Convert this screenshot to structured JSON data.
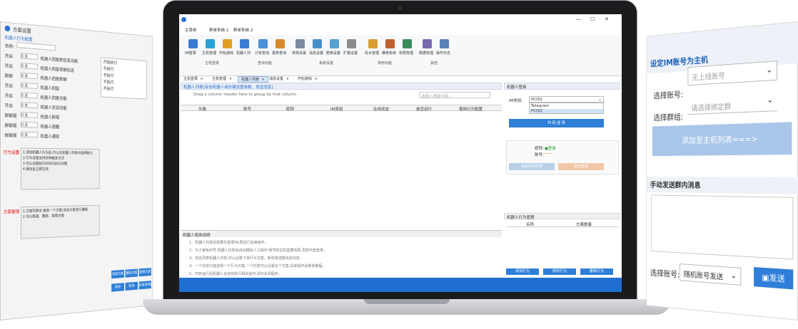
{
  "left_panel": {
    "title": "方案设置",
    "subtitle": "机器人行为配置",
    "name_label": "名称:",
    "rows": [
      {
        "label": "开启",
        "field": "0 关",
        "opt": "机器人回复群信息功能"
      },
      {
        "label": "开启",
        "field": "0 关",
        "opt": "机器人回复单聊信息"
      },
      {
        "label": "群聊",
        "field": "0 关",
        "opt": "机器人回复群聊"
      },
      {
        "label": "开启",
        "field": "0 关",
        "opt": "机器人回复"
      },
      {
        "label": "开启",
        "field": "0 关",
        "opt": "机器人回复功能"
      },
      {
        "label": "开启",
        "field": "0 关",
        "opt": "机器人欢迎功能"
      },
      {
        "label": "群聊规",
        "field": "0 关",
        "opt": "机器人群规"
      },
      {
        "label": "群聊规",
        "field": "0 关",
        "opt": "机器人提醒"
      },
      {
        "label": "群聊规",
        "field": "0 关",
        "opt": "机器人通知"
      }
    ],
    "side_labels": [
      "开始执行",
      "不执行",
      "不执行",
      "不执行",
      "不执行"
    ],
    "behavior_label": "行为设置",
    "plan_label": "方案管理",
    "behavior_text": [
      "1.添加机器人行为后,可以在机器人列表中选择执行",
      "2.行为设置支持多种触发方式",
      "3.可以设置执行时间与执行次数",
      "4.保存后立即生效"
    ],
    "plan_text": [
      "1.方案列表中,每条一个方案,双击方案进行编辑",
      "2.可以新建、删除、复制方案"
    ],
    "buttons": [
      "添加方案",
      "删除方案",
      "复制方案",
      "保存",
      "取消",
      "应用到机器人"
    ]
  },
  "app": {
    "title": "",
    "menu_tabs": [
      "主菜单",
      "群单系统-1",
      "群单系统-2"
    ],
    "window_controls": [
      "—",
      "☐",
      "✕"
    ],
    "ribbon_items": [
      {
        "label": "IM登录",
        "color": "#3a7bd5"
      },
      {
        "label": "主机管理",
        "color": "#27a3d8"
      },
      {
        "label": "开始游戏",
        "color": "#e0a020"
      },
      {
        "label": "机器人列",
        "color": "#3a7bd5"
      },
      {
        "label": "订单查询",
        "color": "#4a8fd8"
      },
      {
        "label": "报表查询",
        "color": "#d8892a"
      },
      {
        "label": "常规设置",
        "color": "#7b8aa0"
      },
      {
        "label": "消息设置",
        "color": "#4a90c8"
      },
      {
        "label": "赔率设置",
        "color": "#5aa0d0"
      },
      {
        "label": "扩展设置",
        "color": "#8c8c8c"
      },
      {
        "label": "反水管理",
        "color": "#d8a030"
      },
      {
        "label": "推荐系统",
        "color": "#c06030"
      },
      {
        "label": "权限管理",
        "color": "#3a8a5a"
      },
      {
        "label": "数据管理",
        "color": "#7a6ab0"
      },
      {
        "label": "操作日志",
        "color": "#5a80b8"
      }
    ],
    "ribbon_groups": [
      "主机登录",
      "查询功能",
      "系统设置",
      "常用功能",
      "其他"
    ],
    "doc_tabs": [
      "主机登录",
      "主机管理",
      "机器人列表",
      "消息设置",
      "开始游戏"
    ],
    "list_panel_title": "机器人列表[双击机器人或右键设置参数、发送消息]",
    "group_hint": "Drag a column header here to group by that column",
    "search_placeholder": "请输入搜索内容...",
    "columns": [
      "头像",
      "账号",
      "昵称",
      "IM类别",
      "在线状态",
      "是否运行",
      "使用行为配置"
    ],
    "instructions_title": "机器人使用说明",
    "instructions": [
      "1、机器人托管后需要先登录IM,再进行后续操作。",
      "2、为了避免封号,机器人托管会自动模拟人工操作,账号和主机需要匹配,否则不能登录。",
      "3、双击列表机器人托管,可以设置下单行为方案。新增发送群消息内容。",
      "4、一个托管只能选择一个行为方案,一个托管可以设置多个方案,具体操作请参考教程。",
      "5、开启运行后机器人会自动执行相关操作,请勿关闭程序。"
    ],
    "im_login": {
      "title": "机器人登录",
      "im_type_label": "IM类别:",
      "im_type_value": "PCQQ",
      "options": [
        "Telegram",
        "PCQQ"
      ],
      "login_button": "扫 码 登 录",
      "nick_label": "昵称:",
      "nick_value": "●登录",
      "account_label": "账号:",
      "account_value": "——",
      "add_button": "添加至IM列表",
      "exit_button": "退出登录"
    },
    "behavior_mgmt": {
      "title": "机器人行为管理",
      "columns": [
        "名称",
        "方案数量"
      ],
      "buttons": [
        "添加行为",
        "修改行为",
        "删除行为"
      ]
    }
  },
  "right_panel": {
    "title": "设定IM账号为主机",
    "select_account_label": "选择账号:",
    "select_account_placeholder": "无上线账号",
    "select_group_label": "选择群组:",
    "select_group_placeholder": "请选择绑定群",
    "add_button": "添加至主机列表===>",
    "manual_title": "手动发送群内消息",
    "send_account_label": "选择账号:",
    "send_account_value": "随机账号发送",
    "send_button": "发送",
    "colors": {
      "title": "#1a5fb4",
      "add_button": "#a9c6ea",
      "send_button": "#2f7fd8"
    }
  }
}
